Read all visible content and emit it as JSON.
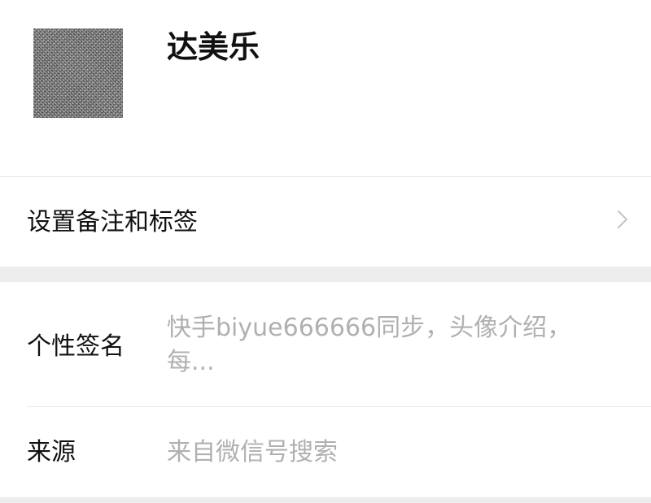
{
  "profile": {
    "name": "达美乐",
    "avatar_icon": "avatar-image"
  },
  "remark": {
    "label": "设置备注和标签",
    "chevron_icon": "chevron-right-icon"
  },
  "signature": {
    "label": "个性签名",
    "value": "快手biyue666666同步，头像介绍，每..."
  },
  "source": {
    "label": "来源",
    "value": "来自微信号搜索"
  },
  "colors": {
    "background": "#ededed",
    "card": "#ffffff",
    "primary_text": "#111111",
    "secondary_text": "#b0b0b0"
  }
}
